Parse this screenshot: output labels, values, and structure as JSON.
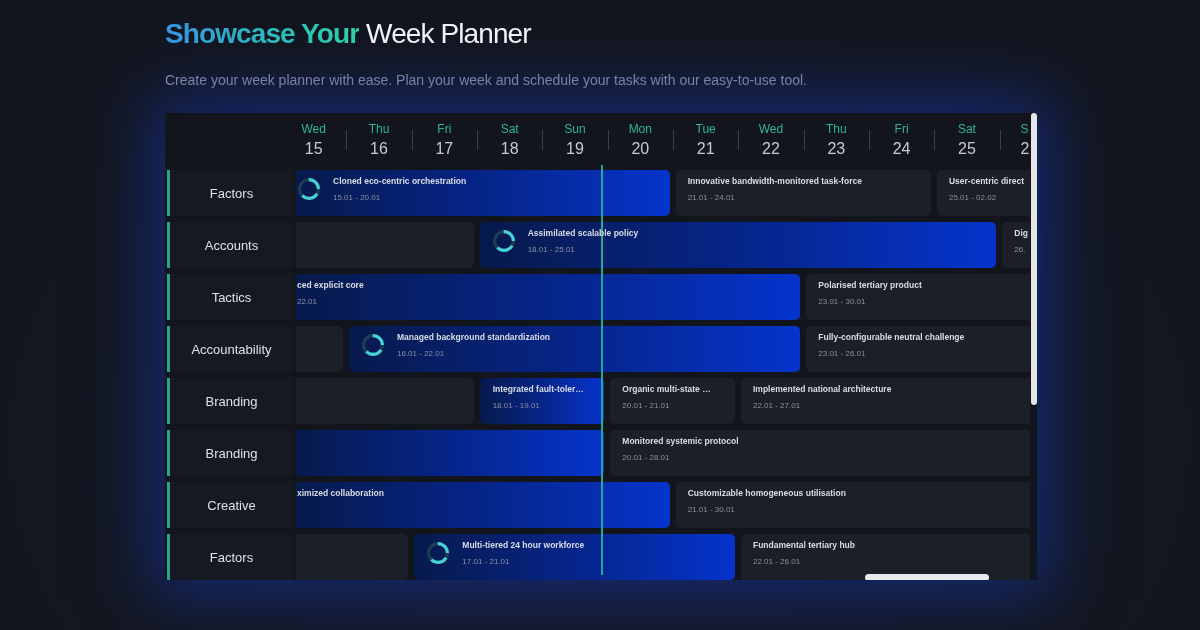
{
  "header": {
    "title": "**Showcase Your** Week Planner",
    "subtitle": "Create your week planner with ease. Plan your week and schedule your tasks with our easy-to-use tool."
  },
  "planner": {
    "days": [
      {
        "weekday": "Wed",
        "date": "15"
      },
      {
        "weekday": "Thu",
        "date": "16"
      },
      {
        "weekday": "Fri",
        "date": "17"
      },
      {
        "weekday": "Sat",
        "date": "18"
      },
      {
        "weekday": "Sun",
        "date": "19"
      },
      {
        "weekday": "Mon",
        "date": "20"
      },
      {
        "weekday": "Tue",
        "date": "21"
      },
      {
        "weekday": "Wed",
        "date": "22"
      },
      {
        "weekday": "Thu",
        "date": "23"
      },
      {
        "weekday": "Fri",
        "date": "24"
      },
      {
        "weekday": "Sat",
        "date": "25"
      },
      {
        "weekday": "S",
        "date": "2"
      }
    ],
    "rows": [
      {
        "label": "Factors",
        "tasks": [
          {
            "kind": "highlight",
            "ring": true,
            "title": "Cloned eco-centric orchestration",
            "dates": "15.01 - 20.01"
          },
          {
            "kind": "plain",
            "ring": false,
            "title": "Innovative bandwidth-monitored task-force",
            "dates": "21.01 - 24.01"
          },
          {
            "kind": "plain",
            "ring": false,
            "title": "User-centric direct",
            "dates": "25.01 - 02.02"
          }
        ]
      },
      {
        "label": "Accounts",
        "tasks": [
          {
            "kind": "plain",
            "ring": false
          },
          {
            "kind": "highlight",
            "ring": true,
            "title": "Assimilated scalable policy",
            "dates": "18.01 - 25.01"
          },
          {
            "kind": "plain",
            "ring": false,
            "title": "Dig",
            "dates": "26."
          }
        ]
      },
      {
        "label": "Tactics",
        "tasks": [
          {
            "kind": "highlight",
            "ring": false,
            "title": "ced explicit core",
            "dates": "22.01"
          },
          {
            "kind": "plain",
            "ring": false,
            "title": "Polarised tertiary product",
            "dates": "23.01 - 30.01"
          }
        ]
      },
      {
        "label": "Accountability",
        "tasks": [
          {
            "kind": "plain",
            "ring": false
          },
          {
            "kind": "highlight",
            "ring": true,
            "title": "Managed background standardization",
            "dates": "16.01 - 22.01"
          },
          {
            "kind": "plain",
            "ring": false,
            "title": "Fully-configurable neutral challenge",
            "dates": "23.01 - 26.01"
          }
        ]
      },
      {
        "label": "Branding",
        "tasks": [
          {
            "kind": "plain",
            "ring": false
          },
          {
            "kind": "highlight",
            "ring": false,
            "title": "Integrated fault-toler…",
            "dates": "18.01 - 19.01"
          },
          {
            "kind": "plain",
            "ring": false,
            "title": "Organic multi-state …",
            "dates": "20.01 - 21.01"
          },
          {
            "kind": "plain",
            "ring": false,
            "title": "Implemented national architecture",
            "dates": "22.01 - 27.01"
          }
        ]
      },
      {
        "label": "Branding",
        "tasks": [
          {
            "kind": "highlight",
            "ring": false
          },
          {
            "kind": "plain",
            "ring": false,
            "title": "Monitored systemic protocol",
            "dates": "20.01 - 28.01"
          }
        ]
      },
      {
        "label": "Creative",
        "tasks": [
          {
            "kind": "highlight",
            "ring": false,
            "title": "ximized collaboration"
          },
          {
            "kind": "plain",
            "ring": false,
            "title": "Customizable homogeneous utilisation",
            "dates": "21.01 - 30.01"
          }
        ]
      },
      {
        "label": "Factors",
        "tasks": [
          {
            "kind": "plain",
            "ring": false
          },
          {
            "kind": "highlight",
            "ring": true,
            "title": "Multi-tiered 24 hour workforce",
            "dates": "17.01 - 21.01"
          },
          {
            "kind": "plain",
            "ring": false,
            "title": "Fundamental tertiary hub",
            "dates": "22.01 - 26.01"
          }
        ]
      }
    ]
  }
}
